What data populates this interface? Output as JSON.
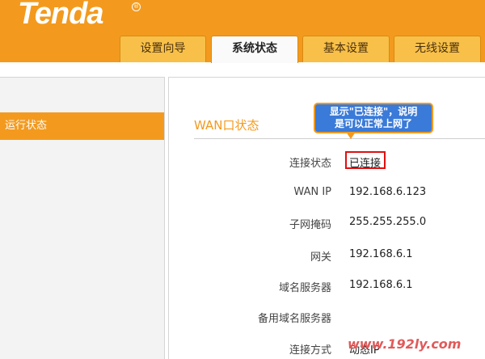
{
  "header": {
    "logo": "Tenda",
    "reg_mark": "®"
  },
  "tabs": [
    {
      "label": "设置向导",
      "active": false
    },
    {
      "label": "系统状态",
      "active": true
    },
    {
      "label": "基本设置",
      "active": false
    },
    {
      "label": "无线设置",
      "active": false
    }
  ],
  "sidebar": {
    "items": [
      {
        "label": "运行状态",
        "active": true
      }
    ]
  },
  "main": {
    "section_title": "WAN口状态",
    "fields": [
      {
        "label": "连接状态",
        "value": "已连接"
      },
      {
        "label": "WAN IP",
        "value": "192.168.6.123"
      },
      {
        "label": "子网掩码",
        "value": "255.255.255.0"
      },
      {
        "label": "网关",
        "value": "192.168.6.1"
      },
      {
        "label": "域名服务器",
        "value": "192.168.6.1"
      },
      {
        "label": "备用域名服务器",
        "value": ""
      },
      {
        "label": "连接方式",
        "value": "动态IP"
      }
    ]
  },
  "annotation": {
    "line1": "显示\"已连接\"，说明",
    "line2": "是可以正常上网了"
  },
  "watermark": "www.192ly.com",
  "colors": {
    "brand_orange": "#f39a1e",
    "tab_yellow": "#f8c048",
    "highlight_red": "#e01010",
    "bubble_blue": "#3a7ad8"
  }
}
